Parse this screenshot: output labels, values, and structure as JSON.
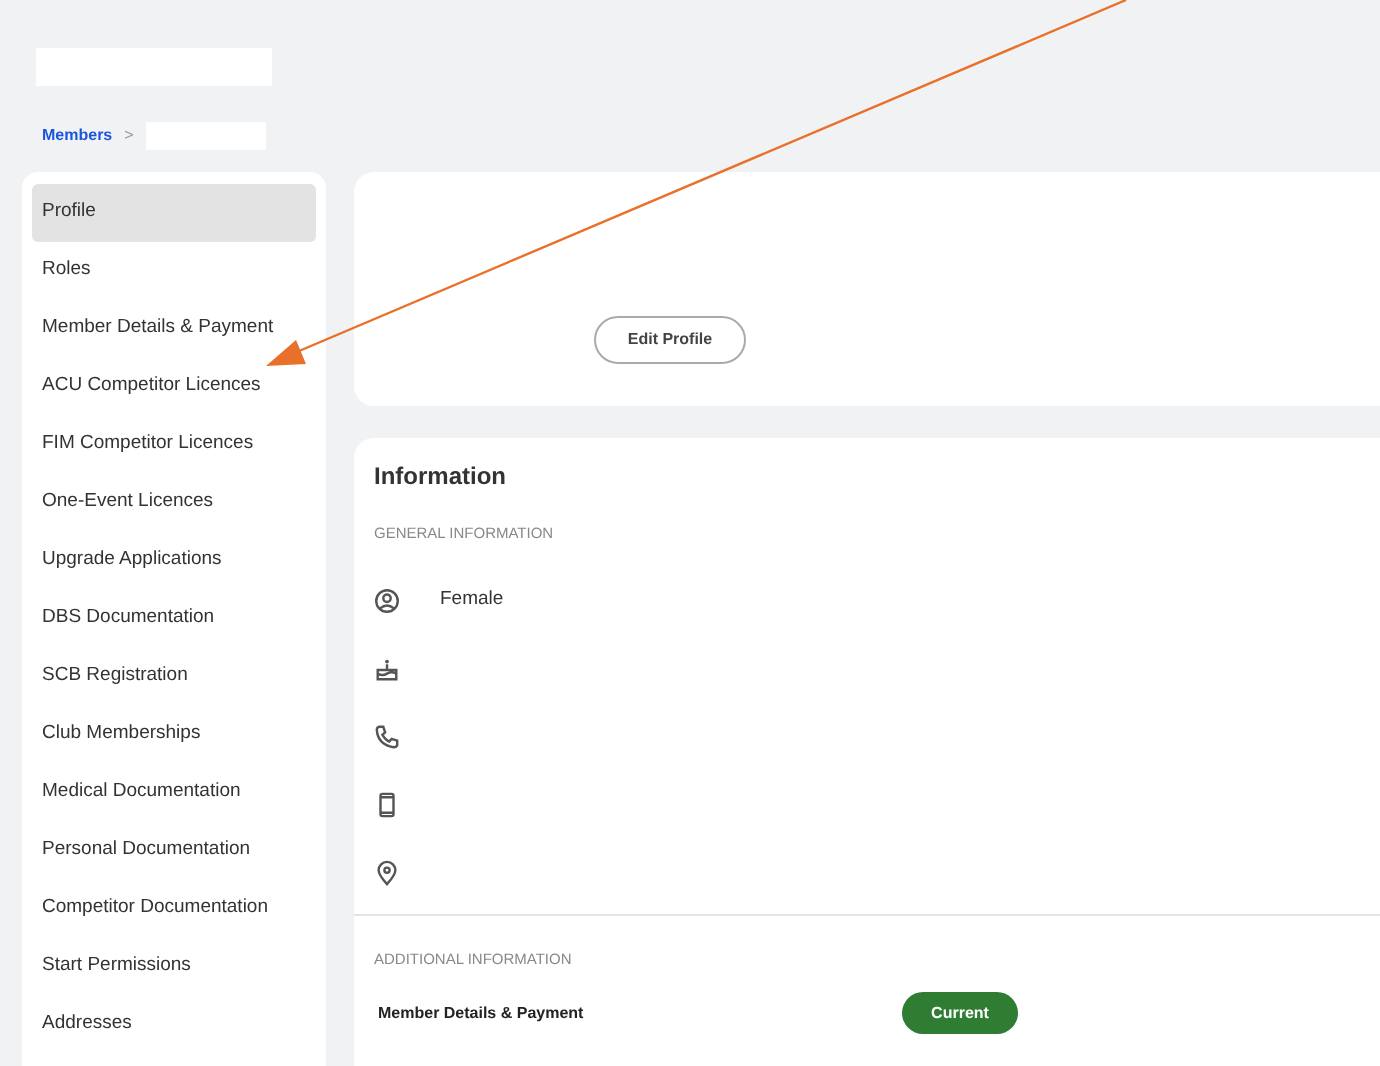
{
  "breadcrumb": {
    "items": [
      "Members"
    ],
    "separator": ">"
  },
  "sidebar": {
    "items": [
      {
        "label": "Profile",
        "selected": true
      },
      {
        "label": "Roles",
        "selected": false
      },
      {
        "label": "Member Details & Payment",
        "selected": false
      },
      {
        "label": "ACU Competitor Licences",
        "selected": false
      },
      {
        "label": "FIM Competitor Licences",
        "selected": false
      },
      {
        "label": "One-Event Licences",
        "selected": false
      },
      {
        "label": "Upgrade Applications",
        "selected": false
      },
      {
        "label": "DBS Documentation",
        "selected": false
      },
      {
        "label": "SCB Registration",
        "selected": false
      },
      {
        "label": "Club Memberships",
        "selected": false
      },
      {
        "label": "Medical Documentation",
        "selected": false
      },
      {
        "label": "Personal Documentation",
        "selected": false
      },
      {
        "label": "Competitor Documentation",
        "selected": false
      },
      {
        "label": "Start Permissions",
        "selected": false
      },
      {
        "label": "Addresses",
        "selected": false
      }
    ]
  },
  "profile_card": {
    "button": "Edit Profile"
  },
  "information": {
    "title": "Information",
    "general": {
      "heading": "GENERAL INFORMATION",
      "rows": [
        {
          "kind": "person",
          "text": "Female"
        },
        {
          "kind": "cake"
        },
        {
          "kind": "phone"
        },
        {
          "kind": "mobile"
        },
        {
          "kind": "location"
        }
      ]
    },
    "additional": {
      "heading": "ADDITIONAL INFORMATION",
      "rows": [
        {
          "label": "Member Details & Payment",
          "status": "Current"
        }
      ]
    }
  }
}
